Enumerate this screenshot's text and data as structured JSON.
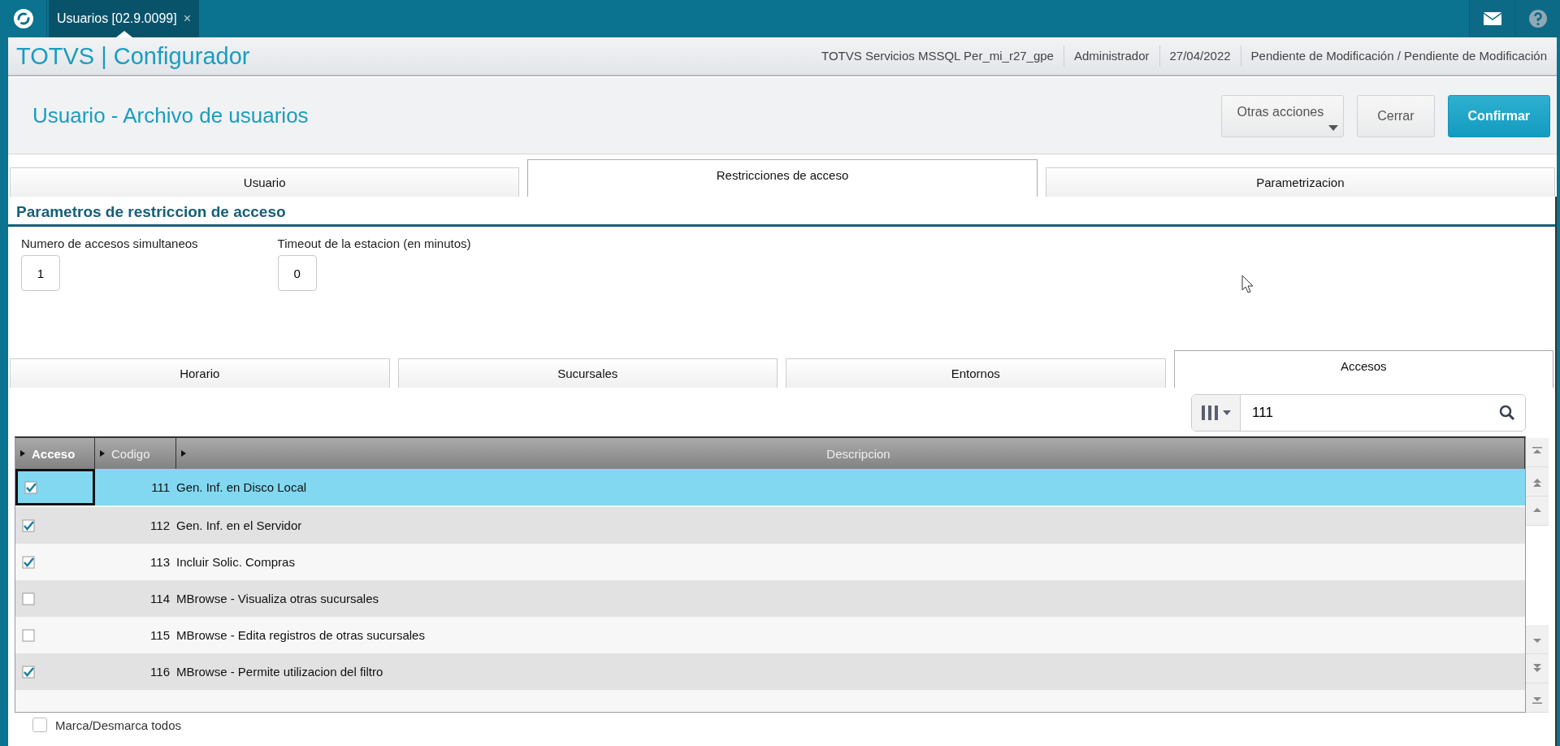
{
  "topbar": {
    "tab": {
      "label": "Usuarios [02.9.0099]",
      "close": "×",
      "selected": true
    }
  },
  "header": {
    "title": "TOTVS | Configurador",
    "info": [
      "TOTVS Servicios MSSQL Per_mi_r27_gpe",
      "Administrador",
      "27/04/2022",
      "Pendiente de Modificación / Pendiente de Modificación"
    ]
  },
  "page": {
    "title": "Usuario - Archivo de usuarios",
    "buttons": [
      {
        "label": "Otras acciones",
        "kind": "menu"
      },
      {
        "label": "Cerrar",
        "kind": "default"
      },
      {
        "label": "Confirmar",
        "kind": "primary"
      }
    ]
  },
  "tabs": [
    {
      "label": "Usuario",
      "selected": false
    },
    {
      "label": "Restricciones de acceso",
      "selected": true
    },
    {
      "label": "Parametrizacion",
      "selected": false
    }
  ],
  "section": {
    "title": "Parametros de restriccion de acceso",
    "fields": [
      {
        "label": "Numero de accesos simultaneos",
        "value": "1"
      },
      {
        "label": "Timeout de la estacion (en minutos)",
        "value": "0"
      }
    ]
  },
  "subtabs": [
    {
      "label": "Horario",
      "selected": false
    },
    {
      "label": "Sucursales",
      "selected": false
    },
    {
      "label": "Entornos",
      "selected": false
    },
    {
      "label": "Accesos",
      "selected": true
    }
  ],
  "search": {
    "value": "111"
  },
  "table": {
    "columns": [
      {
        "label": "Acceso",
        "bold": true
      },
      {
        "label": "Codigo",
        "bold": false
      },
      {
        "label": "Descripcion",
        "bold": false
      }
    ],
    "rows": [
      {
        "checked": true,
        "code": "111",
        "description": "Gen. Inf. en Disco Local",
        "selected": true
      },
      {
        "checked": true,
        "code": "112",
        "description": "Gen. Inf. en el Servidor",
        "selected": false
      },
      {
        "checked": true,
        "code": "113",
        "description": "Incluir Solic. Compras",
        "selected": false
      },
      {
        "checked": false,
        "code": "114",
        "description": "MBrowse - Visualiza otras sucursales",
        "selected": false
      },
      {
        "checked": false,
        "code": "115",
        "description": "MBrowse - Edita registros de otras sucursales",
        "selected": false
      },
      {
        "checked": true,
        "code": "116",
        "description": "MBrowse - Permite utilizacion del filtro",
        "selected": false
      }
    ]
  },
  "toggle_all": {
    "label": "Marca/Desmarca todos",
    "checked": false
  }
}
